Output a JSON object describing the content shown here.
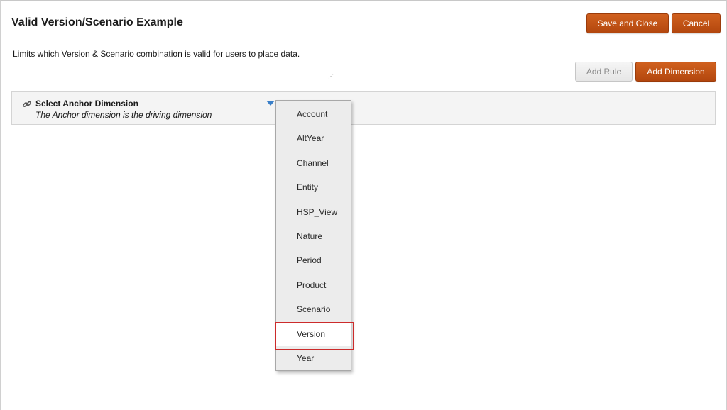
{
  "header": {
    "title": "Valid Version/Scenario Example",
    "save_close_label": "Save and Close",
    "cancel_label": "Cancel"
  },
  "description": "Limits which Version & Scenario combination is valid for users to place data.",
  "toolbar": {
    "add_rule_label": "Add Rule",
    "add_dimension_label": "Add Dimension"
  },
  "resize_grip": ".:|",
  "anchor": {
    "icon": "link-icon",
    "title": "Select Anchor Dimension",
    "subtitle": "The Anchor dimension is the driving dimension"
  },
  "dropdown": {
    "items": [
      "Account",
      "AltYear",
      "Channel",
      "Entity",
      "HSP_View",
      "Nature",
      "Period",
      "Product",
      "Scenario",
      "Version",
      "Year"
    ],
    "highlighted": "Version"
  },
  "colors": {
    "accent_orange": "#c0521a",
    "highlight_red": "#cc2b2b",
    "dropdown_arrow": "#3a7fc8"
  }
}
